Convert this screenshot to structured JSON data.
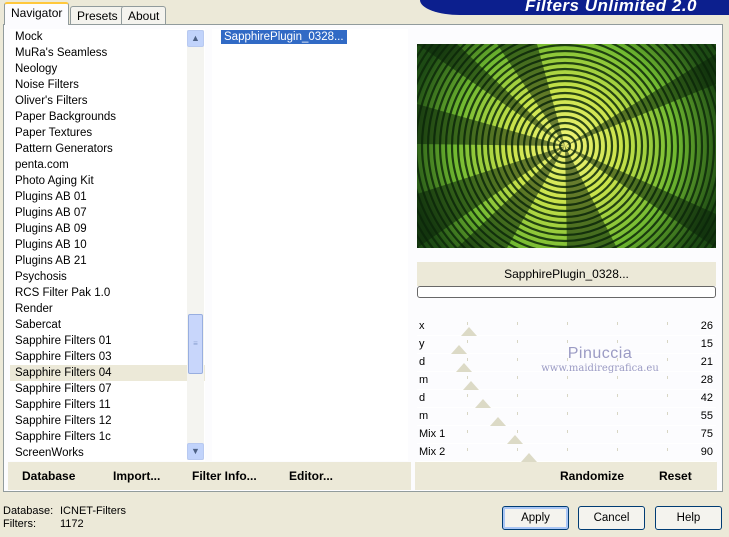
{
  "banner": {
    "title": "Filters Unlimited 2.0"
  },
  "tabs": [
    {
      "label": "Navigator",
      "active": true
    },
    {
      "label": "Presets",
      "active": false
    },
    {
      "label": "About",
      "active": false
    }
  ],
  "categories": [
    "Mock",
    "MuRa's Seamless",
    "Neology",
    "Noise Filters",
    "Oliver's Filters",
    "Paper Backgrounds",
    "Paper Textures",
    "Pattern Generators",
    "penta.com",
    "Photo Aging Kit",
    "Plugins AB 01",
    "Plugins AB 07",
    "Plugins AB 09",
    "Plugins AB 10",
    "Plugins AB 21",
    "Psychosis",
    "RCS Filter Pak 1.0",
    "Render",
    "Sabercat",
    "Sapphire Filters 01",
    "Sapphire Filters 03",
    "Sapphire Filters 04",
    "Sapphire Filters 07",
    "Sapphire Filters 11",
    "Sapphire Filters 12",
    "Sapphire Filters 1c",
    "ScreenWorks"
  ],
  "selected_category": "Sapphire Filters 04",
  "filters": {
    "selected": "SapphirePlugin_0328..."
  },
  "preview": {
    "label": "SapphirePlugin_0328..."
  },
  "sliders": [
    {
      "label": "x",
      "value": "26",
      "level": 0.1
    },
    {
      "label": "y",
      "value": "15",
      "level": 0.06
    },
    {
      "label": "d",
      "value": "21",
      "level": 0.08
    },
    {
      "label": "m",
      "value": "28",
      "level": 0.11
    },
    {
      "label": "d",
      "value": "42",
      "level": 0.16
    },
    {
      "label": "m",
      "value": "55",
      "level": 0.22
    },
    {
      "label": "Mix 1",
      "value": "75",
      "level": 0.29
    },
    {
      "label": "Mix 2",
      "value": "90",
      "level": 0.35
    }
  ],
  "watermark": {
    "line1": "Pinuccia",
    "line2": "www.maidiregrafica.eu"
  },
  "left_buttons": [
    "Database",
    "Import...",
    "Filter Info...",
    "Editor..."
  ],
  "right_buttons": [
    "Randomize",
    "Reset"
  ],
  "footer": {
    "database_label": "Database:",
    "database_value": "ICNET-Filters",
    "filters_label": "Filters:",
    "filters_value": "1172"
  },
  "dialog_buttons": {
    "apply": "Apply",
    "cancel": "Cancel",
    "help": "Help"
  },
  "colors": {
    "selection": "#316ac5",
    "banner": "#0c1f8e",
    "preview_green": "#8fbe2c"
  }
}
